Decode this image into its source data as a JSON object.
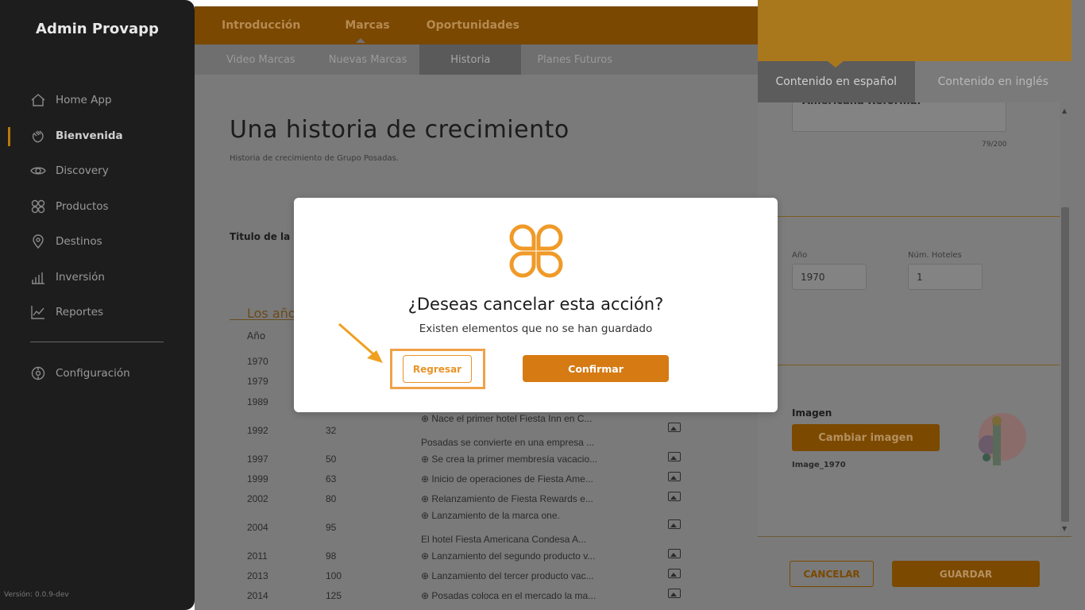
{
  "sidebar": {
    "brand": "Admin Provapp",
    "items": [
      {
        "label": "Home App",
        "icon": "home-icon"
      },
      {
        "label": "Bienvenida",
        "icon": "hand-wave-icon"
      },
      {
        "label": "Discovery",
        "icon": "eye-icon"
      },
      {
        "label": "Productos",
        "icon": "grid-icon"
      },
      {
        "label": "Destinos",
        "icon": "location-pin-icon"
      },
      {
        "label": "Inversión",
        "icon": "bar-chart-icon"
      },
      {
        "label": "Reportes",
        "icon": "line-chart-icon"
      },
      {
        "label": "Configuración",
        "icon": "gear-icon"
      }
    ],
    "active": "Bienvenida",
    "version": "Versión: 0.0.9-dev"
  },
  "topnav": {
    "tabs": [
      "Introducción",
      "Marcas",
      "Oportunidades"
    ],
    "active": "Marcas"
  },
  "subnav": {
    "tabs": [
      "Video Marcas",
      "Nuevas Marcas",
      "Historia",
      "Planes Futuros"
    ],
    "active": "Historia"
  },
  "main": {
    "title": "Una historia de crecimiento",
    "subtitle": "Historia de crecimiento de Grupo Posadas.",
    "title_label": "Titulo de la pá",
    "section_title": "Los año",
    "col_year": "Año",
    "rows": [
      {
        "year": "1970",
        "hotels": "",
        "desc": ""
      },
      {
        "year": "1979",
        "hotels": "",
        "desc": ""
      },
      {
        "year": "1989",
        "hotels": "",
        "desc": ""
      },
      {
        "year": "",
        "hotels": "",
        "desc": "⊕ Nace el primer hotel Fiesta Inn en C..."
      },
      {
        "year": "1992",
        "hotels": "32",
        "desc": ""
      },
      {
        "year": "",
        "hotels": "",
        "desc": "Posadas se convierte en una empresa ..."
      },
      {
        "year": "1997",
        "hotels": "50",
        "desc": "⊕ Se crea la primer membresía vacacio..."
      },
      {
        "year": "1999",
        "hotels": "63",
        "desc": "⊕ Inicio de operaciones de Fiesta Ame..."
      },
      {
        "year": "2002",
        "hotels": "80",
        "desc": "⊕ Relanzamiento de Fiesta Rewards e..."
      },
      {
        "year": "",
        "hotels": "",
        "desc": "⊕ Lanzamiento de la marca one."
      },
      {
        "year": "2004",
        "hotels": "95",
        "desc": ""
      },
      {
        "year": "",
        "hotels": "",
        "desc": "El hotel Fiesta Americana Condesa A..."
      },
      {
        "year": "2011",
        "hotels": "98",
        "desc": "⊕ Lanzamiento del segundo producto v..."
      },
      {
        "year": "2013",
        "hotels": "100",
        "desc": "⊕ Lanzamiento del tercer producto vac..."
      },
      {
        "year": "2014",
        "hotels": "125",
        "desc": "⊕ Posadas coloca en el mercado la ma..."
      }
    ]
  },
  "panel": {
    "tab_es": "Contenido en español",
    "tab_en": "Contenido en inglés",
    "textarea_value": "Americana Reforma.",
    "counter": "79/200",
    "year_label": "Año",
    "year_value": "1970",
    "hotels_label": "Núm. Hoteles",
    "hotels_value": "1",
    "image_label": "Imagen",
    "change_image": "Cambiar imagen",
    "image_name": "Image_1970",
    "cancel": "CANCELAR",
    "save": "GUARDAR"
  },
  "modal": {
    "title": "¿Deseas cancelar esta acción?",
    "message": "Existen elementos que no se han guardado",
    "back": "Regresar",
    "confirm": "Confirmar"
  },
  "colors": {
    "accent": "#d67a13",
    "highlight": "#f0a14a"
  }
}
